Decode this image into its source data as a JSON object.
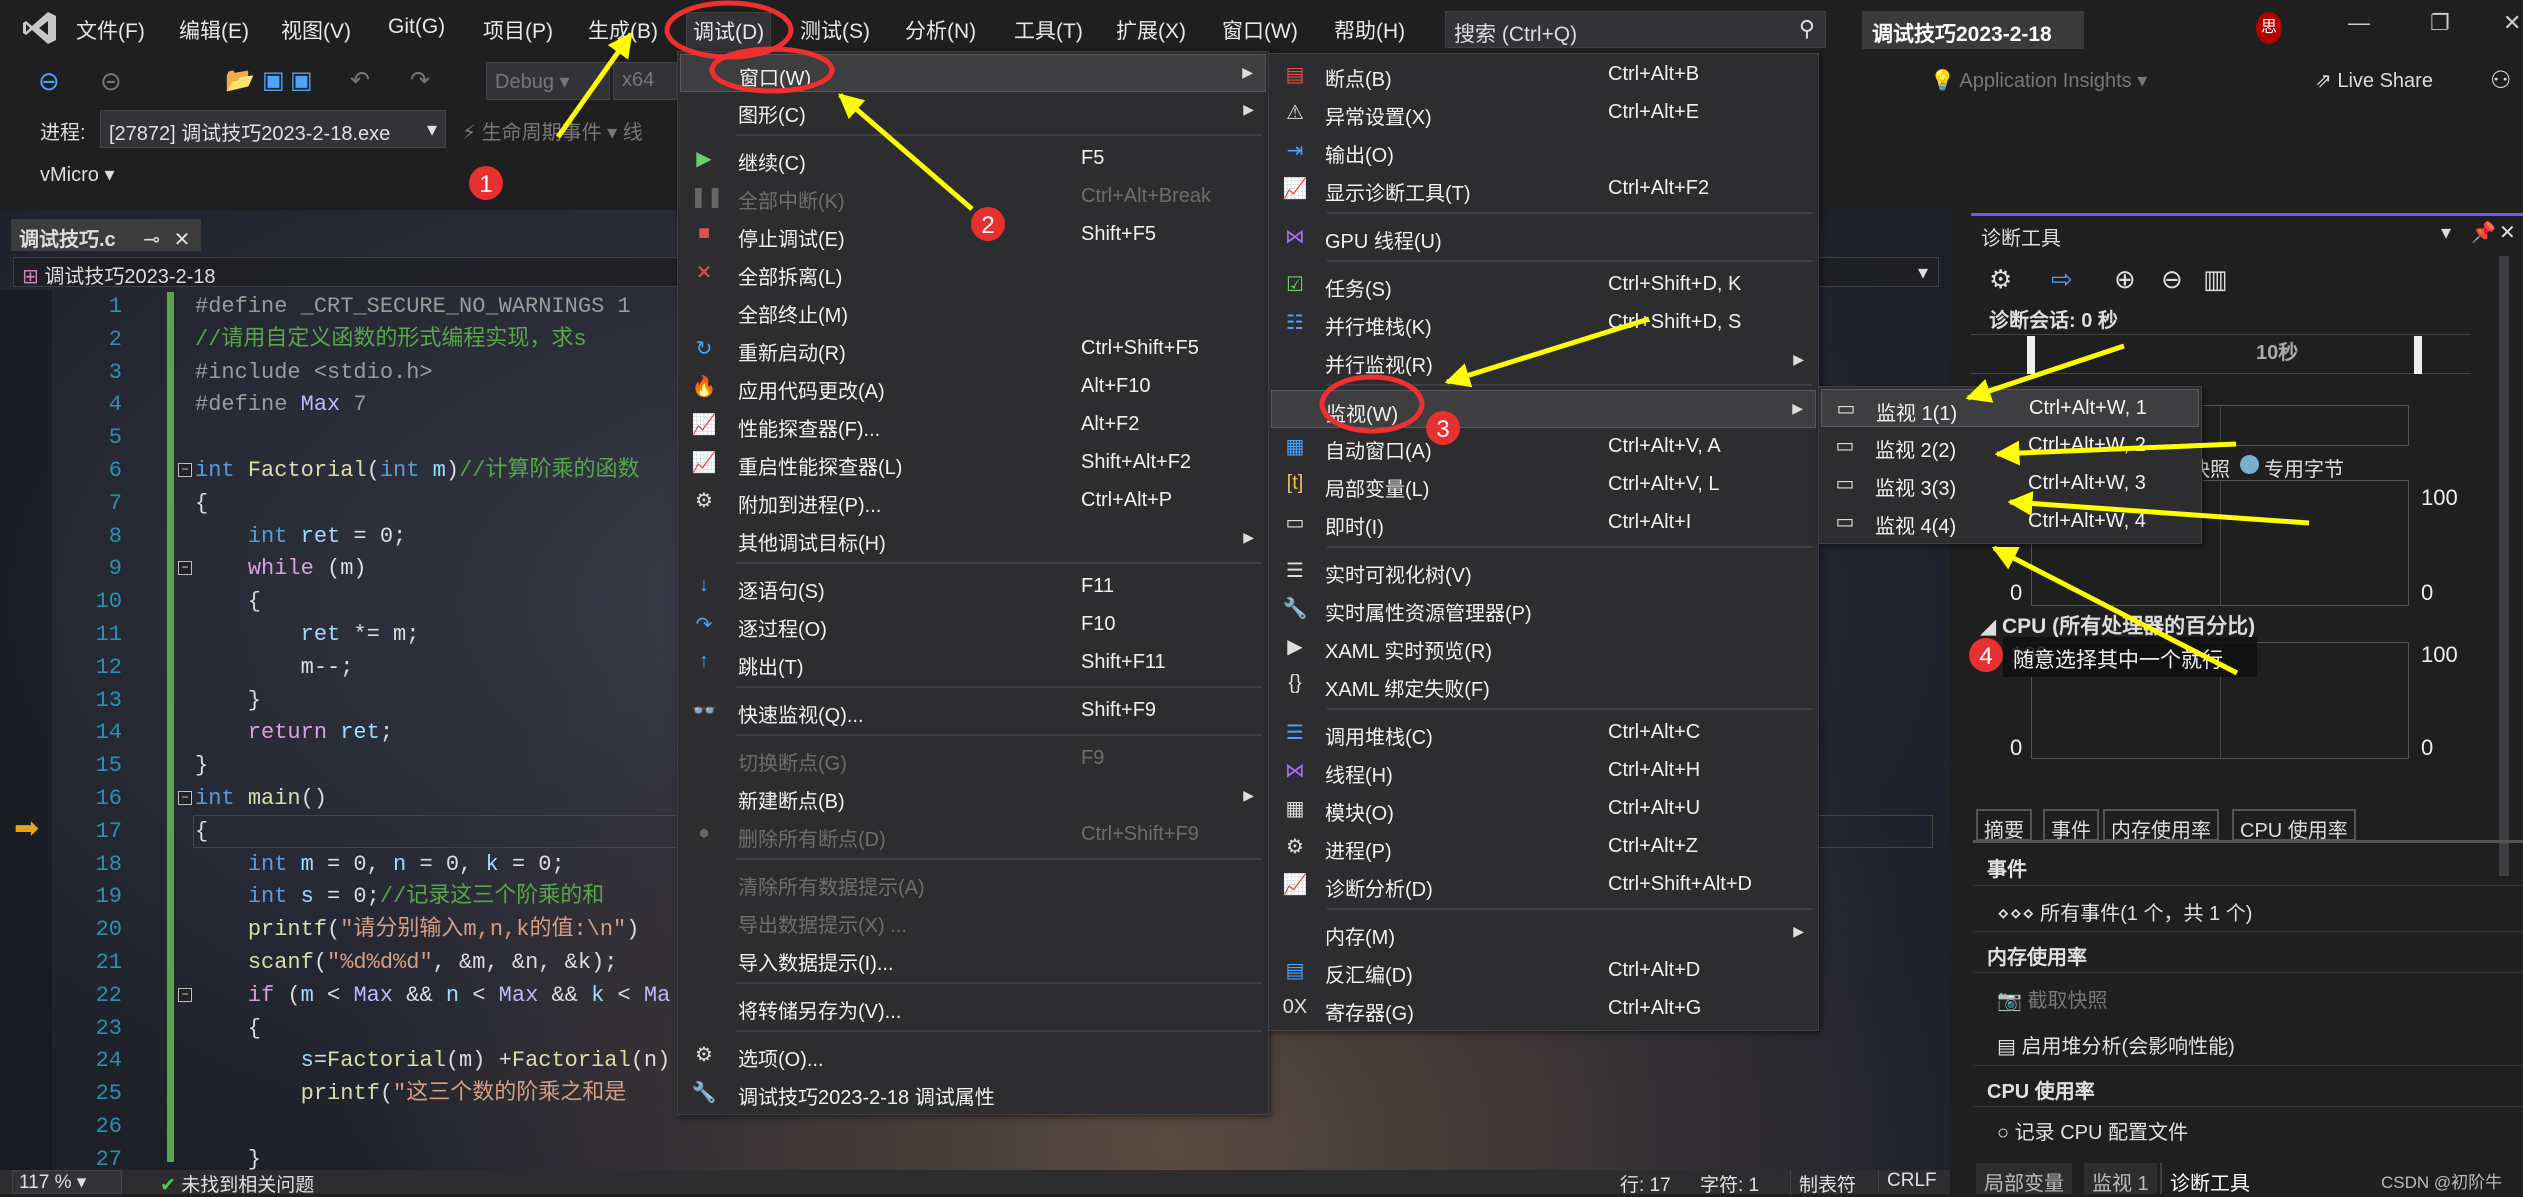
{
  "menubar": {
    "items": [
      "文件(F)",
      "编辑(E)",
      "视图(V)",
      "Git(G)",
      "项目(P)",
      "生成(B)",
      "调试(D)",
      "测试(S)",
      "分析(N)",
      "工具(T)",
      "扩展(X)",
      "窗口(W)",
      "帮助(H)"
    ],
    "active_index": 6,
    "search_placeholder": "搜索 (Ctrl+Q)",
    "project_title": "调试技巧2023-2-18",
    "avatar": "思"
  },
  "toolbar": {
    "config": "Debug",
    "platform": "x64",
    "process_label": "进程:",
    "process_value": "[27872] 调试技巧2023-2-18.exe",
    "lifecycle": "生命周期事件",
    "thread_label": "线",
    "vmicro": "vMicro",
    "app_insights": "Application Insights",
    "live_share": "Live Share"
  },
  "editor": {
    "tab_label": "调试技巧.c",
    "nav_project": "调试技巧2023-2-18",
    "zoom": "117 %",
    "issues": "未找到相关问题",
    "current_line": 17,
    "fold_lines": [
      6,
      9,
      16,
      22
    ],
    "lines": [
      [
        [
          "p",
          "#define _CRT_SECURE_NO_WARNINGS 1"
        ]
      ],
      [
        [
          "c",
          "//请用自定义函数的形式编程实现，求s"
        ]
      ],
      [
        [
          "p",
          "#include <stdio.h>"
        ]
      ],
      [
        [
          "p",
          "#define "
        ],
        [
          "m",
          "Max"
        ],
        [
          "p",
          " 7"
        ]
      ],
      [],
      [
        [
          "k",
          "int "
        ],
        [
          "f",
          "Factorial"
        ],
        [
          "t",
          "("
        ],
        [
          "k",
          "int "
        ],
        [
          "v",
          "m"
        ],
        [
          "t",
          ")"
        ],
        [
          "c",
          "//计算阶乘的函数"
        ]
      ],
      [
        [
          "t",
          "{"
        ]
      ],
      [
        [
          "t",
          "    "
        ],
        [
          "k",
          "int "
        ],
        [
          "v",
          "ret"
        ],
        [
          "t",
          " = 0;"
        ]
      ],
      [
        [
          "t",
          "    "
        ],
        [
          "ck",
          "while"
        ],
        [
          "t",
          " (m)"
        ]
      ],
      [
        [
          "t",
          "    {"
        ]
      ],
      [
        [
          "t",
          "        "
        ],
        [
          "v",
          "ret"
        ],
        [
          "t",
          " *= m;"
        ]
      ],
      [
        [
          "t",
          "        m--;"
        ]
      ],
      [
        [
          "t",
          "    }"
        ]
      ],
      [
        [
          "t",
          "    "
        ],
        [
          "ck",
          "return"
        ],
        [
          "t",
          " "
        ],
        [
          "v",
          "ret"
        ],
        [
          "t",
          ";"
        ]
      ],
      [
        [
          "t",
          "}"
        ]
      ],
      [
        [
          "k",
          "int "
        ],
        [
          "f",
          "main"
        ],
        [
          "t",
          "()"
        ]
      ],
      [
        [
          "t",
          "{"
        ]
      ],
      [
        [
          "t",
          "    "
        ],
        [
          "k",
          "int "
        ],
        [
          "v",
          "m"
        ],
        [
          "t",
          " = 0, "
        ],
        [
          "v",
          "n"
        ],
        [
          "t",
          " = 0, "
        ],
        [
          "v",
          "k"
        ],
        [
          "t",
          " = 0;"
        ]
      ],
      [
        [
          "t",
          "    "
        ],
        [
          "k",
          "int "
        ],
        [
          "v",
          "s"
        ],
        [
          "t",
          " = 0;"
        ],
        [
          "c",
          "//记录这三个阶乘的和"
        ]
      ],
      [
        [
          "t",
          "    "
        ],
        [
          "f",
          "printf"
        ],
        [
          "t",
          "("
        ],
        [
          "s",
          "\"请分别输入m,n,k的值:\\n\""
        ],
        [
          "t",
          ")"
        ]
      ],
      [
        [
          "t",
          "    "
        ],
        [
          "f",
          "scanf"
        ],
        [
          "t",
          "("
        ],
        [
          "s",
          "\"%d%d%d\""
        ],
        [
          "t",
          ", &m, &n, &k);"
        ]
      ],
      [
        [
          "t",
          "    "
        ],
        [
          "ck",
          "if"
        ],
        [
          "t",
          " ("
        ],
        [
          "v",
          "m"
        ],
        [
          "t",
          " < "
        ],
        [
          "m",
          "Max"
        ],
        [
          "t",
          " && "
        ],
        [
          "v",
          "n"
        ],
        [
          "t",
          " < "
        ],
        [
          "m",
          "Max"
        ],
        [
          "t",
          " && "
        ],
        [
          "v",
          "k"
        ],
        [
          "t",
          " < "
        ],
        [
          "m",
          "Ma"
        ]
      ],
      [
        [
          "t",
          "    {"
        ]
      ],
      [
        [
          "t",
          "        "
        ],
        [
          "v",
          "s"
        ],
        [
          "t",
          "="
        ],
        [
          "f",
          "Factorial"
        ],
        [
          "t",
          "(m) +"
        ],
        [
          "f",
          "Factorial"
        ],
        [
          "t",
          "(n)"
        ]
      ],
      [
        [
          "t",
          "        "
        ],
        [
          "f",
          "printf"
        ],
        [
          "t",
          "("
        ],
        [
          "s",
          "\"这三个数的阶乘之和是"
        ]
      ],
      [],
      [
        [
          "t",
          "    }"
        ]
      ]
    ]
  },
  "debug_menu": {
    "groups": [
      [
        {
          "label": "窗口(W)",
          "submenu": true,
          "highlighted": true
        },
        {
          "label": "图形(C)",
          "submenu": true
        }
      ],
      [
        {
          "label": "继续(C)",
          "shortcut": "F5",
          "icon": "play"
        },
        {
          "label": "全部中断(K)",
          "shortcut": "Ctrl+Alt+Break",
          "icon": "pause",
          "disabled": true
        },
        {
          "label": "停止调试(E)",
          "shortcut": "Shift+F5",
          "icon": "stop"
        },
        {
          "label": "全部拆离(L)",
          "icon": "detach"
        },
        {
          "label": "全部终止(M)"
        },
        {
          "label": "重新启动(R)",
          "shortcut": "Ctrl+Shift+F5",
          "icon": "restart"
        },
        {
          "label": "应用代码更改(A)",
          "shortcut": "Alt+F10",
          "icon": "flame"
        },
        {
          "label": "性能探查器(F)...",
          "shortcut": "Alt+F2",
          "icon": "chart"
        },
        {
          "label": "重启性能探查器(L)",
          "shortcut": "Shift+Alt+F2",
          "icon": "chart"
        },
        {
          "label": "附加到进程(P)...",
          "shortcut": "Ctrl+Alt+P",
          "icon": "attach"
        },
        {
          "label": "其他调试目标(H)",
          "submenu": true
        }
      ],
      [
        {
          "label": "逐语句(S)",
          "shortcut": "F11",
          "icon": "step-into"
        },
        {
          "label": "逐过程(O)",
          "shortcut": "F10",
          "icon": "step-over"
        },
        {
          "label": "跳出(T)",
          "shortcut": "Shift+F11",
          "icon": "step-out"
        }
      ],
      [
        {
          "label": "快速监视(Q)...",
          "shortcut": "Shift+F9",
          "icon": "glasses"
        }
      ],
      [
        {
          "label": "切换断点(G)",
          "shortcut": "F9",
          "disabled": true
        },
        {
          "label": "新建断点(B)",
          "submenu": true
        },
        {
          "label": "删除所有断点(D)",
          "shortcut": "Ctrl+Shift+F9",
          "icon": "delete-breakpoints",
          "disabled": true
        }
      ],
      [
        {
          "label": "清除所有数据提示(A)",
          "disabled": true
        },
        {
          "label": "导出数据提示(X) ...",
          "disabled": true
        },
        {
          "label": "导入数据提示(I)..."
        }
      ],
      [
        {
          "label": "将转储另存为(V)..."
        }
      ],
      [
        {
          "label": "选项(O)...",
          "icon": "gear"
        },
        {
          "label": "调试技巧2023-2-18 调试属性",
          "icon": "wrench"
        }
      ]
    ]
  },
  "window_menu": {
    "groups": [
      [
        {
          "label": "断点(B)",
          "shortcut": "Ctrl+Alt+B",
          "icon": "breakpoints"
        },
        {
          "label": "异常设置(X)",
          "shortcut": "Ctrl+Alt+E",
          "icon": "exception"
        },
        {
          "label": "输出(O)",
          "icon": "output"
        },
        {
          "label": "显示诊断工具(T)",
          "shortcut": "Ctrl+Alt+F2",
          "icon": "diagnostics"
        }
      ],
      [
        {
          "label": "GPU 线程(U)",
          "icon": "gpu-threads"
        }
      ],
      [
        {
          "label": "任务(S)",
          "shortcut": "Ctrl+Shift+D, K",
          "icon": "tasks"
        },
        {
          "label": "并行堆栈(K)",
          "shortcut": "Ctrl+Shift+D, S",
          "icon": "parallel-stacks"
        },
        {
          "label": "并行监视(R)",
          "submenu": true
        }
      ],
      [
        {
          "label": "监视(W)",
          "submenu": true,
          "highlighted": true
        },
        {
          "label": "自动窗口(A)",
          "shortcut": "Ctrl+Alt+V, A",
          "icon": "autos"
        },
        {
          "label": "局部变量(L)",
          "shortcut": "Ctrl+Alt+V, L",
          "icon": "locals"
        },
        {
          "label": "即时(I)",
          "shortcut": "Ctrl+Alt+I",
          "icon": "immediate"
        }
      ],
      [
        {
          "label": "实时可视化树(V)",
          "icon": "visual-tree"
        },
        {
          "label": "实时属性资源管理器(P)",
          "icon": "property-explorer"
        },
        {
          "label": "XAML 实时预览(R)",
          "icon": "xaml-preview"
        },
        {
          "label": "XAML 绑定失败(F)",
          "icon": "xaml-binding"
        }
      ],
      [
        {
          "label": "调用堆栈(C)",
          "shortcut": "Ctrl+Alt+C",
          "icon": "call-stack"
        },
        {
          "label": "线程(H)",
          "shortcut": "Ctrl+Alt+H",
          "icon": "threads"
        },
        {
          "label": "模块(O)",
          "shortcut": "Ctrl+Alt+U",
          "icon": "modules"
        },
        {
          "label": "进程(P)",
          "shortcut": "Ctrl+Alt+Z",
          "icon": "processes"
        },
        {
          "label": "诊断分析(D)",
          "shortcut": "Ctrl+Shift+Alt+D",
          "icon": "diagnostic-analysis"
        }
      ],
      [
        {
          "label": "内存(M)",
          "submenu": true
        },
        {
          "label": "反汇编(D)",
          "shortcut": "Ctrl+Alt+D",
          "icon": "disassembly"
        },
        {
          "label": "寄存器(G)",
          "shortcut": "Ctrl+Alt+G",
          "icon": "registers"
        }
      ]
    ]
  },
  "watch_menu": {
    "groups": [
      [
        {
          "label": "监视 1(1)",
          "shortcut": "Ctrl+Alt+W, 1",
          "icon": "watch",
          "highlighted": true
        },
        {
          "label": "监视 2(2)",
          "shortcut": "Ctrl+Alt+W, 2",
          "icon": "watch"
        },
        {
          "label": "监视 3(3)",
          "shortcut": "Ctrl+Alt+W, 3",
          "icon": "watch"
        },
        {
          "label": "监视 4(4)",
          "shortcut": "Ctrl+Alt+W, 4",
          "icon": "watch"
        }
      ]
    ]
  },
  "diagnostics": {
    "title": "诊断工具",
    "session": "诊断会话: 0 秒",
    "ruler_label": "10秒",
    "legend_snapshot": "快照",
    "legend_private": "专用字节",
    "legend_private_color": "#7ab0cc",
    "mem_max": "100",
    "mem_min": "0",
    "cpu_header": "CPU (所有处理器的百分比)",
    "cpu_max": "100",
    "cpu_min": "0",
    "tabs": [
      "摘要",
      "事件",
      "内存使用率",
      "CPU 使用率"
    ],
    "events_heading": "事件",
    "all_events": "所有事件(1 个，共 1 个)",
    "memory_heading": "内存使用率",
    "take_snapshot": "截取快照",
    "heap_analysis": "启用堆分析(会影响性能)",
    "cpu_heading": "CPU 使用率",
    "record_cpu": "记录 CPU 配置文件"
  },
  "bottom_tabs": [
    "局部变量",
    "监视 1",
    "诊断工具"
  ],
  "statusbar": {
    "line": "行: 17",
    "char": "字符: 1",
    "tabs": "制表符",
    "eol": "CRLF"
  },
  "annotations": {
    "badges": [
      "1",
      "2",
      "3",
      "4"
    ],
    "tooltip": "随意选择其中一个就行",
    "watermark": "CSDN @初阶牛"
  }
}
